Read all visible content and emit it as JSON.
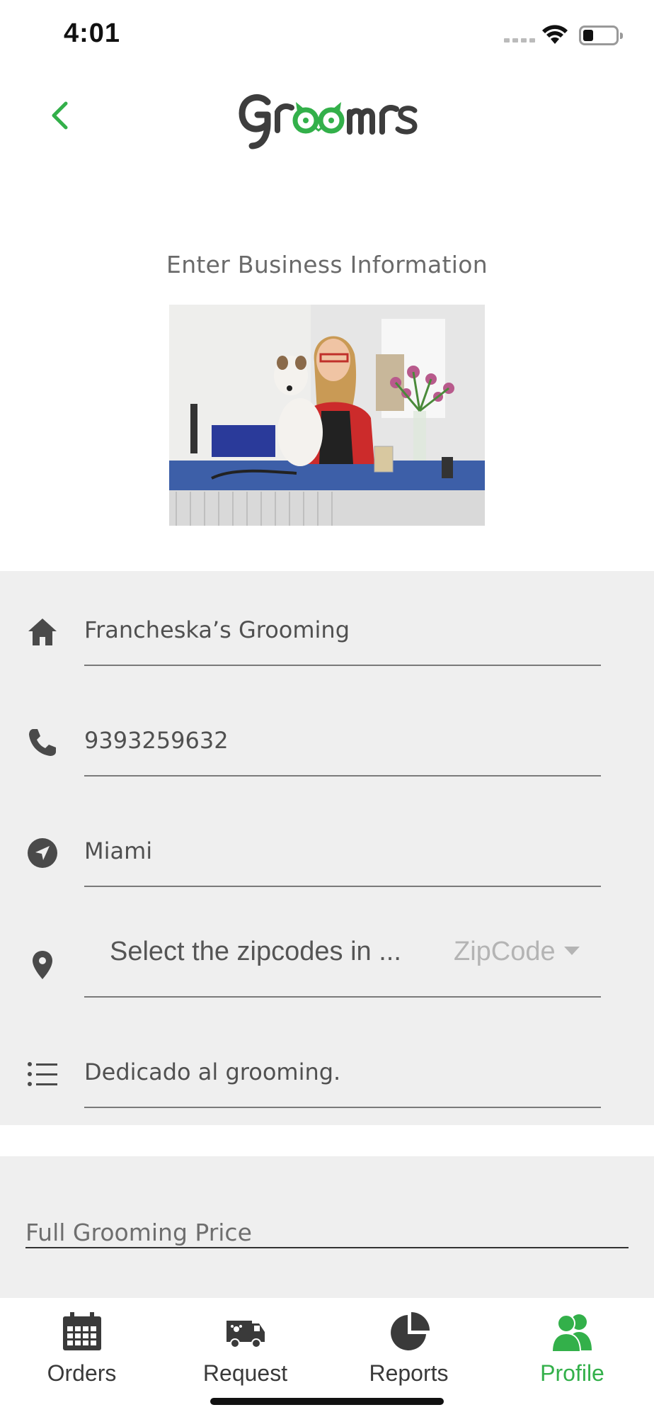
{
  "status_bar": {
    "time": "4:01"
  },
  "header": {
    "back_icon": "chevron-left-icon",
    "logo_text": "Groomrs"
  },
  "colors": {
    "accent": "#33b04a",
    "panel": "#efefef"
  },
  "section_title": "Enter Business Information",
  "form": {
    "business_name": "Francheska’s Grooming",
    "phone": "9393259632",
    "city": "Miami",
    "zip_prompt": "Select the zipcodes in ...",
    "zip_value": "ZipCode",
    "description": "Dedicado al grooming."
  },
  "pricing": {
    "full_grooming_label": "Full Grooming Price"
  },
  "tabs": [
    {
      "label": "Orders",
      "icon": "calendar-icon"
    },
    {
      "label": "Request",
      "icon": "van-icon"
    },
    {
      "label": "Reports",
      "icon": "pie-chart-icon"
    },
    {
      "label": "Profile",
      "icon": "users-icon",
      "active": true
    }
  ]
}
